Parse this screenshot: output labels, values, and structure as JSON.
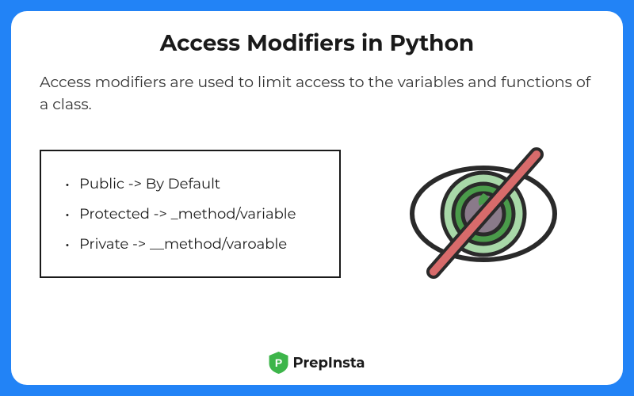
{
  "title": "Access Modifiers in Python",
  "description": "Access modifiers are used to limit access to the variables and functions of a class.",
  "modifiers": {
    "public": "Public -> By Default",
    "protected": "Protected -> _method/variable",
    "private": "Private -> __method/varoable"
  },
  "brand": {
    "name": "PrepInsta",
    "logo_letter": "P"
  }
}
